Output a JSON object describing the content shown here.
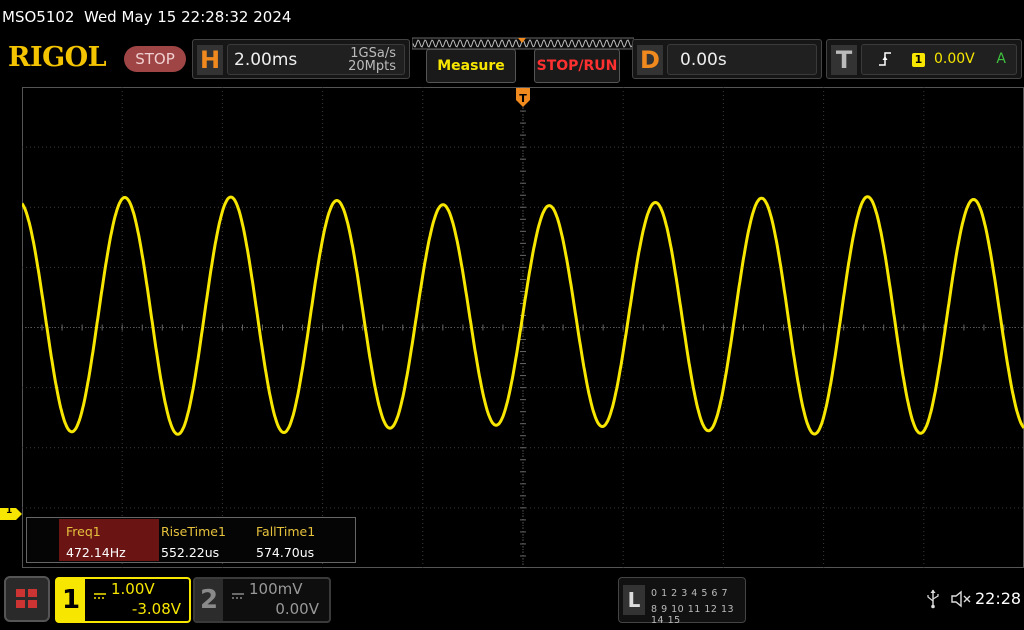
{
  "title": {
    "model": "MSO5102",
    "datetime": "Wed May 15 22:28:32 2024"
  },
  "brand": "RIGOL",
  "run_state": "STOP",
  "horizontal": {
    "letter": "H",
    "timebase": "2.00ms",
    "sample_rate": "1GSa/s",
    "memory_depth": "20Mpts"
  },
  "buttons": {
    "measure": "Measure",
    "stop_run": "STOP/RUN"
  },
  "delay": {
    "letter": "D",
    "value": "0.00s"
  },
  "trigger": {
    "letter": "T",
    "source": "1",
    "level": "0.00V",
    "mode": "A"
  },
  "markers": {
    "channel1_ground": "1"
  },
  "measurements": {
    "headers": [
      "Freq1",
      "RiseTime1",
      "FallTime1"
    ],
    "values": [
      "472.14Hz",
      "552.22us",
      "574.70us"
    ]
  },
  "channel1": {
    "number": "1",
    "scale": "1.00V",
    "offset": "-3.08V"
  },
  "channel2": {
    "number": "2",
    "scale": "100mV",
    "offset": "0.00V"
  },
  "logic_panel": {
    "letter": "L",
    "row1": "0 1 2 3   4 5 6 7",
    "row2": "8 9 10 11  12 13 14 15"
  },
  "status": {
    "time": "22:28"
  },
  "colors": {
    "channel1": "#f7e600",
    "trigger": "#f08a1e",
    "stop": "#a04545",
    "stop_run_text": "#ff3030",
    "grid": "#3a3a3a"
  },
  "waveform": {
    "frequency_hz": 472.14,
    "time_per_div_ms": 2.0,
    "horizontal_divisions": 10,
    "vertical_divisions": 8,
    "amplitude_divisions": 1.9,
    "offset_divisions": 0.2
  }
}
